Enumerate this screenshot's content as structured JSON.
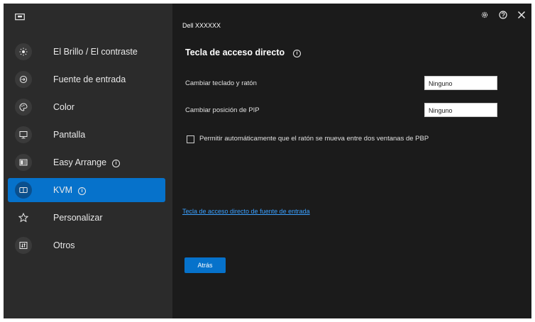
{
  "sidebar": {
    "items": [
      {
        "label": "El Brillo / El contraste",
        "icon": "sun-icon",
        "active": false
      },
      {
        "label": "Fuente de entrada",
        "icon": "input-source-icon",
        "active": false
      },
      {
        "label": "Color",
        "icon": "color-palette-icon",
        "active": false
      },
      {
        "label": "Pantalla",
        "icon": "monitor-icon",
        "active": false
      },
      {
        "label": "Easy Arrange",
        "icon": "easy-arrange-icon",
        "active": false,
        "info": true
      },
      {
        "label": "KVM",
        "icon": "kvm-icon",
        "active": true,
        "info": true
      },
      {
        "label": "Personalizar",
        "icon": "star-icon",
        "active": false
      },
      {
        "label": "Otros",
        "icon": "others-icon",
        "active": false
      }
    ]
  },
  "header": {
    "monitor_name": "Dell XXXXXX",
    "icons": [
      "settings-icon",
      "help-icon",
      "close-icon"
    ]
  },
  "main": {
    "title": "Tecla de acceso directo",
    "rows": [
      {
        "label": "Cambiar teclado y ratón",
        "value": "Ninguno"
      },
      {
        "label": "Cambiar posición de PIP",
        "value": "Ninguno"
      }
    ],
    "checkbox": {
      "label": "Permitir automáticamente que el ratón se mueva entre dos ventanas de PBP",
      "checked": false
    },
    "link": "Tecla de acceso directo de fuente de entrada",
    "back_button": "Atrás"
  },
  "colors": {
    "accent": "#0672cb",
    "sidebar_bg": "#2b2b2b",
    "main_bg": "#1b1b1b",
    "link": "#3aa0ff"
  }
}
